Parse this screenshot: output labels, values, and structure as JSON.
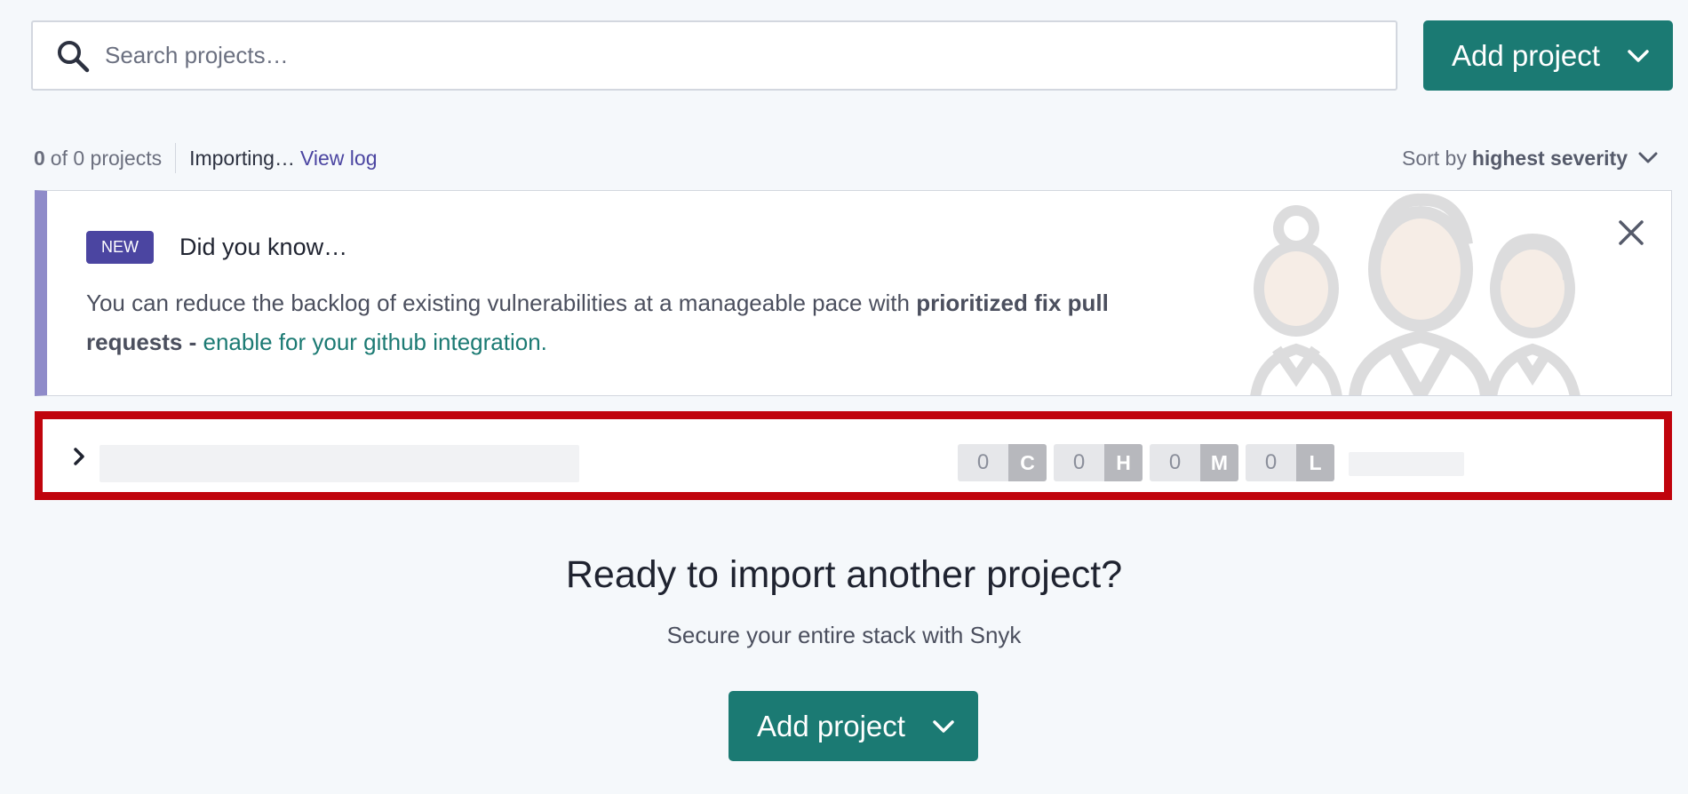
{
  "search": {
    "placeholder": "Search projects…"
  },
  "add_project": {
    "label": "Add project"
  },
  "meta": {
    "count": "0",
    "count_text": "of 0 projects",
    "importing": "Importing…",
    "view_log": "View log"
  },
  "sort": {
    "prefix": "Sort by",
    "value": "highest severity"
  },
  "banner": {
    "badge": "NEW",
    "title": "Did you know…",
    "text_start": "You can reduce the backlog of existing vulnerabilities at a manageable pace with ",
    "text_bold": "prioritized fix pull requests",
    "text_dash": " - ",
    "link": "enable for your github integration."
  },
  "project_row": {
    "severities": [
      {
        "count": "0",
        "label": "C"
      },
      {
        "count": "0",
        "label": "H"
      },
      {
        "count": "0",
        "label": "M"
      },
      {
        "count": "0",
        "label": "L"
      }
    ]
  },
  "empty_state": {
    "title": "Ready to import another project?",
    "subtitle": "Secure your entire stack with Snyk",
    "button": "Add project"
  },
  "colors": {
    "brand_teal": "#1b7a73",
    "brand_purple": "#4b45a1",
    "highlight_red": "#c0040d"
  }
}
